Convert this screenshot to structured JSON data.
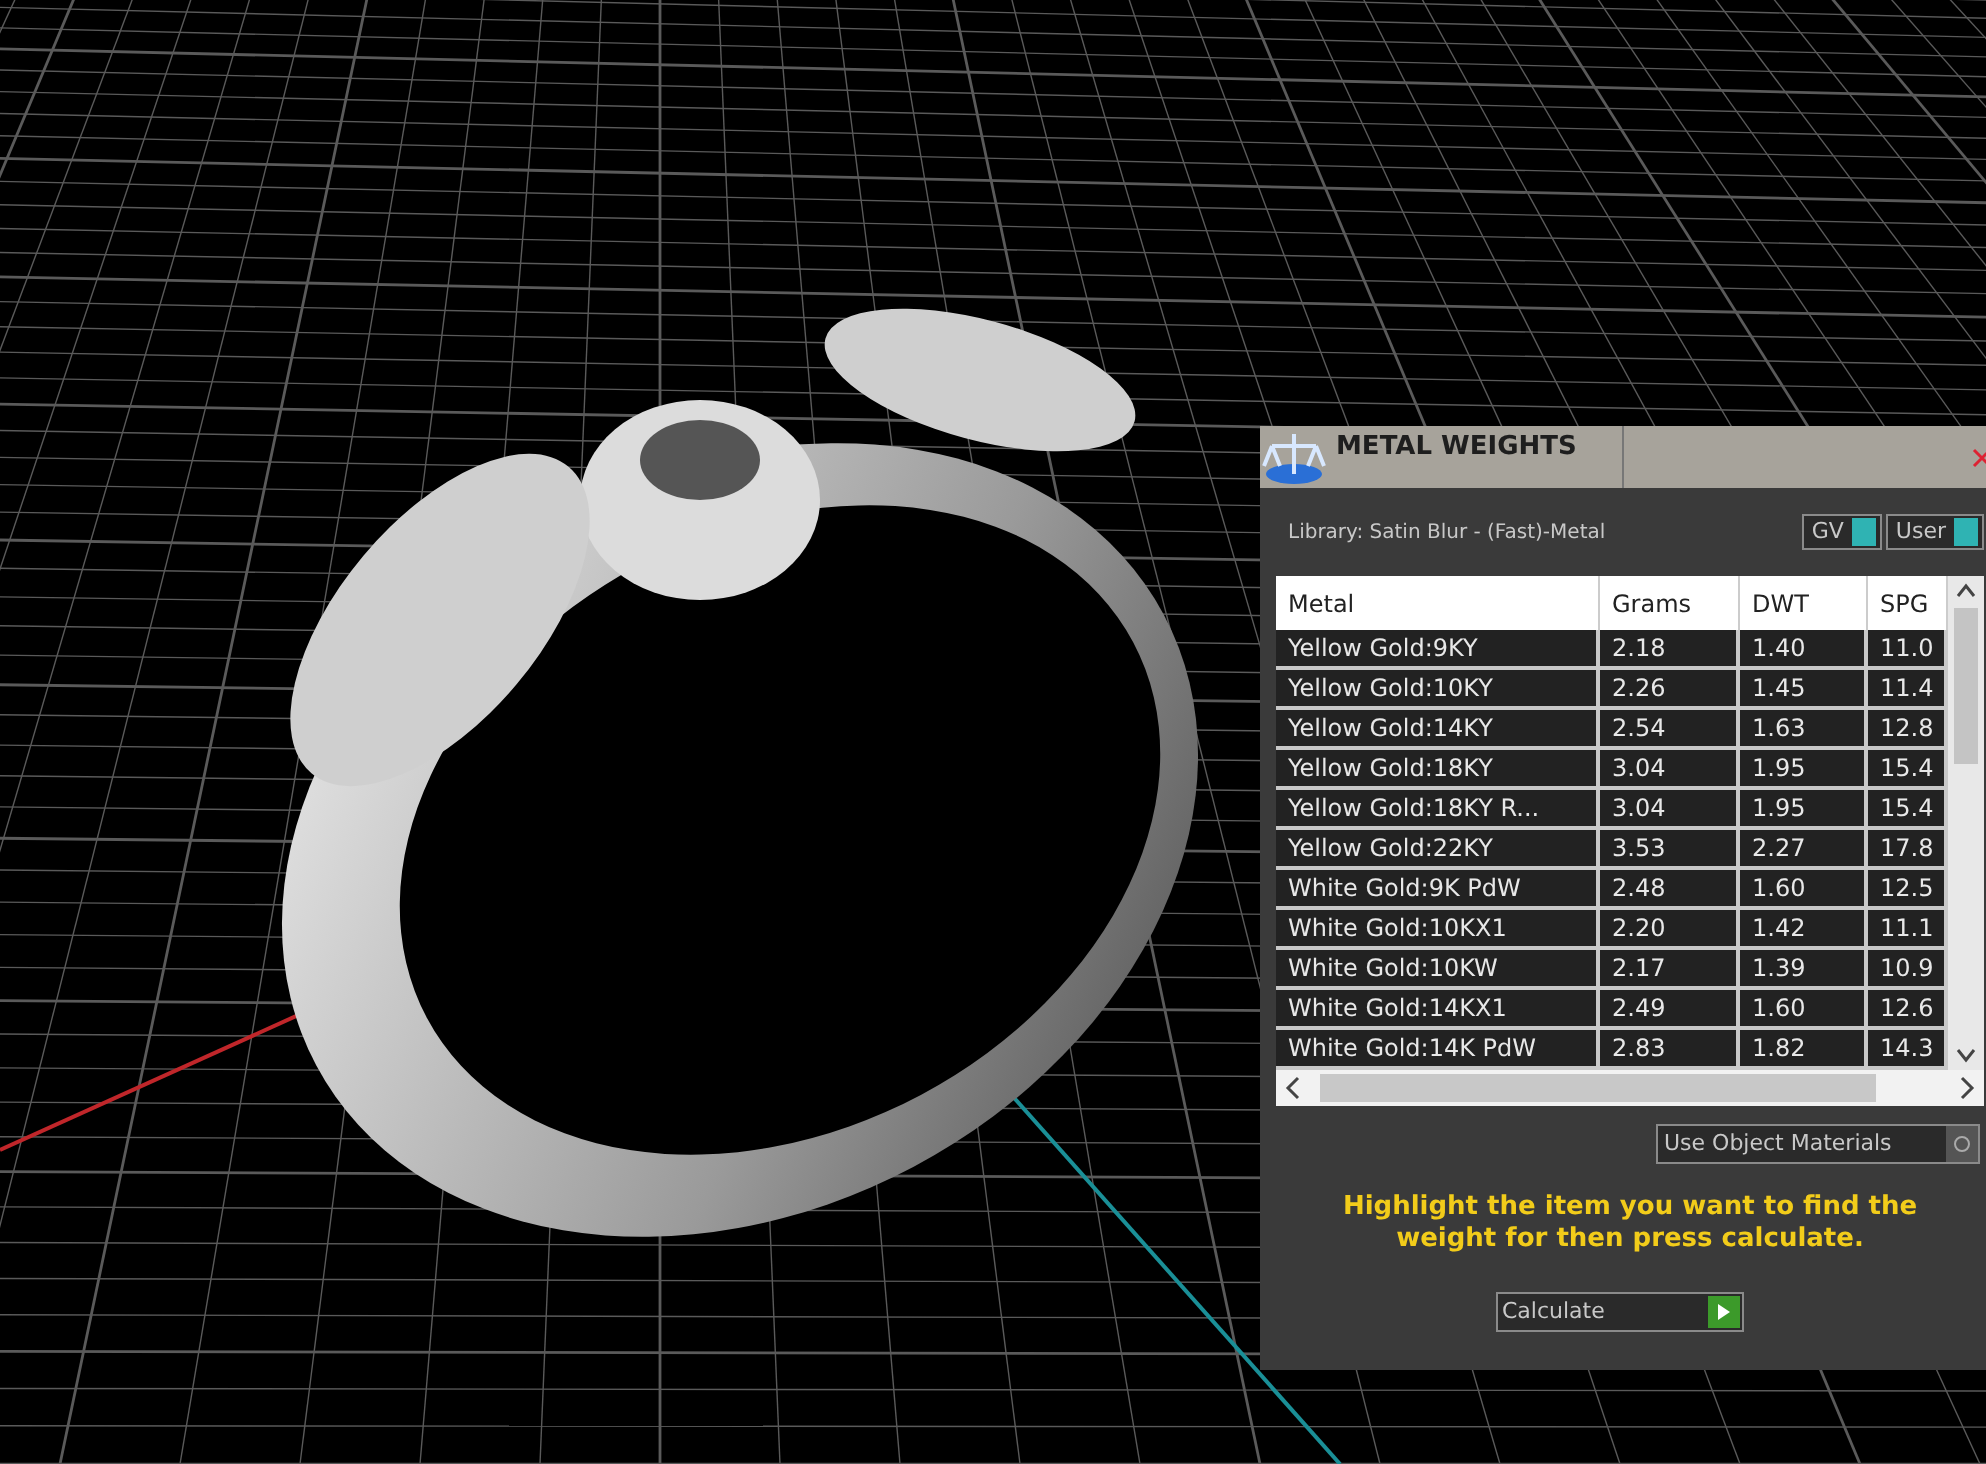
{
  "panel": {
    "title": "METAL WEIGHTS",
    "library": "Library: Satin Blur - (Fast)-Metal",
    "toggles": [
      {
        "label": "GV",
        "on": true
      },
      {
        "label": "User",
        "on": true
      }
    ],
    "table": {
      "columns": [
        "Metal",
        "Grams",
        "DWT",
        "SPG"
      ],
      "rows": [
        {
          "cells": [
            "Yellow Gold:9KY",
            "2.18",
            "1.40",
            "11.0"
          ]
        },
        {
          "cells": [
            "Yellow Gold:10KY",
            "2.26",
            "1.45",
            "11.4"
          ]
        },
        {
          "cells": [
            "Yellow Gold:14KY",
            "2.54",
            "1.63",
            "12.8"
          ]
        },
        {
          "cells": [
            "Yellow Gold:18KY",
            "3.04",
            "1.95",
            "15.4"
          ]
        },
        {
          "cells": [
            "Yellow Gold:18KY R...",
            "3.04",
            "1.95",
            "15.4"
          ]
        },
        {
          "cells": [
            "Yellow Gold:22KY",
            "3.53",
            "2.27",
            "17.8"
          ]
        },
        {
          "cells": [
            "White Gold:9K PdW",
            "2.48",
            "1.60",
            "12.5"
          ]
        },
        {
          "cells": [
            "White Gold:10KX1",
            "2.20",
            "1.42",
            "11.1"
          ]
        },
        {
          "cells": [
            "White Gold:10KW",
            "2.17",
            "1.39",
            "10.9"
          ]
        },
        {
          "cells": [
            "White Gold:14KX1",
            "2.49",
            "1.60",
            "12.6"
          ]
        },
        {
          "cells": [
            "White Gold:14K PdW",
            "2.83",
            "1.82",
            "14.3"
          ]
        }
      ]
    },
    "use_object_materials": {
      "label": "Use Object Materials",
      "on": false
    },
    "message": "Highlight the item you want to find the weight for then press calculate.",
    "calculate_button": "Calculate"
  }
}
